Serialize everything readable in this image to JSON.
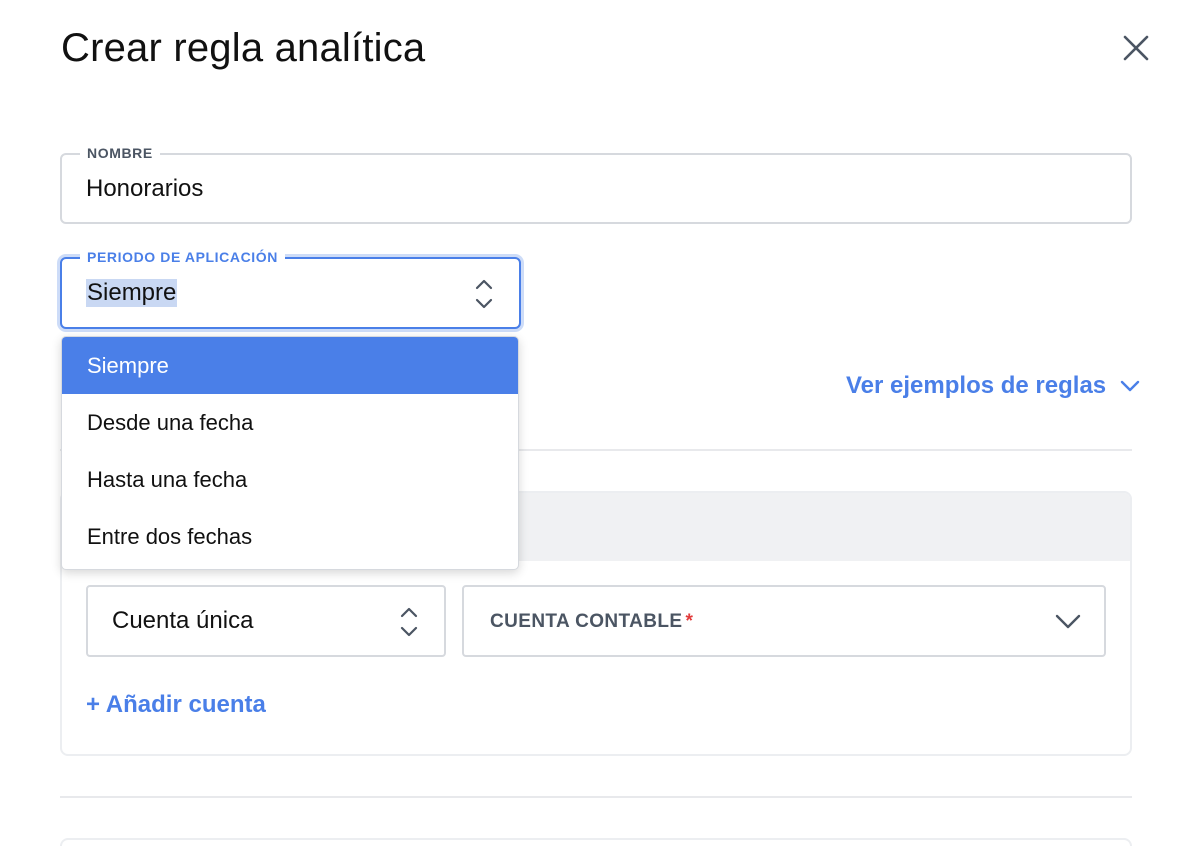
{
  "dialog": {
    "title": "Crear regla analítica"
  },
  "form": {
    "nombre": {
      "label": "NOMBRE",
      "value": "Honorarios"
    },
    "periodo": {
      "label": "PERIODO DE APLICACIÓN",
      "value": "Siempre",
      "options": [
        {
          "label": "Siempre",
          "selected": true
        },
        {
          "label": "Desde una fecha",
          "selected": false
        },
        {
          "label": "Hasta una fecha",
          "selected": false
        },
        {
          "label": "Entre dos fechas",
          "selected": false
        }
      ]
    },
    "examples_link": "Ver ejemplos de reglas",
    "cuenta_tipo": {
      "value": "Cuenta única"
    },
    "cuenta_contable": {
      "label": "CUENTA CONTABLE",
      "required_mark": "*"
    },
    "add_account_link": "+ Añadir cuenta"
  },
  "colors": {
    "accent": "#4a7fe8",
    "required": "#e23b3b",
    "selection_highlight": "#c9d8f3"
  },
  "icons": {
    "close": "close-icon",
    "stepper": "chevron-up-down-icon",
    "chevron": "chevron-down-icon"
  }
}
